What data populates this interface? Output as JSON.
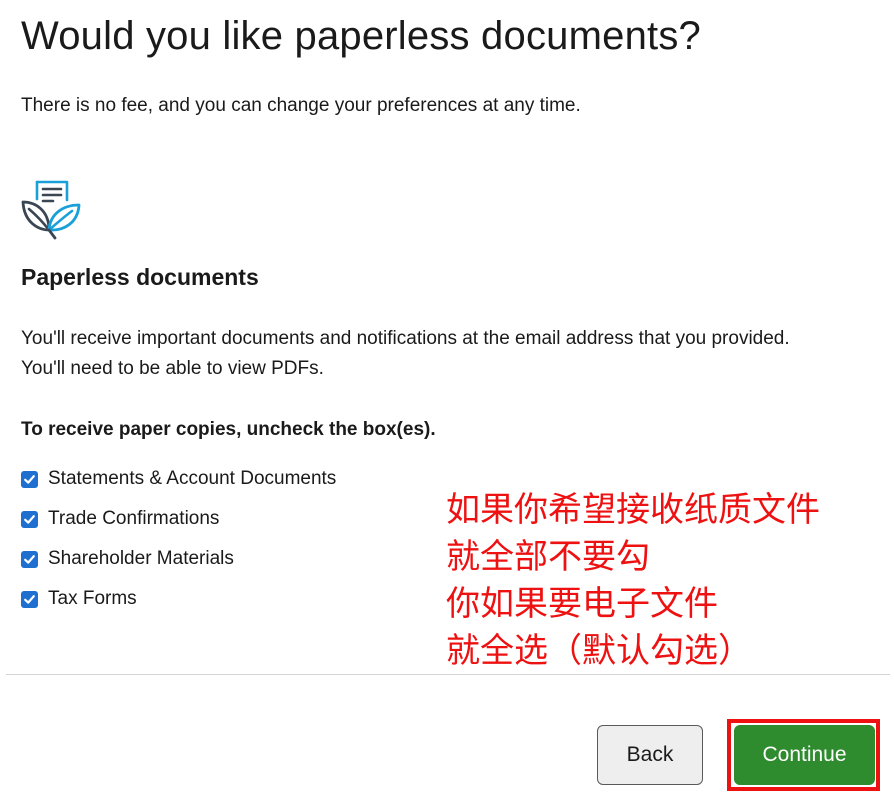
{
  "page": {
    "title": "Would you like paperless documents?",
    "subtitle": "There is no fee, and you can change your preferences at any time."
  },
  "paperless": {
    "icon": "paperless-document-leaf-icon",
    "heading": "Paperless documents",
    "description_line_1": "You'll receive important documents and notifications at the email address that you provided.",
    "description_line_2": "You'll need to be able to view PDFs.",
    "instruction": "To receive paper copies, uncheck the box(es).",
    "options": [
      {
        "label": "Statements & Account Documents",
        "checked": true
      },
      {
        "label": "Trade Confirmations",
        "checked": true
      },
      {
        "label": "Shareholder Materials",
        "checked": true
      },
      {
        "label": "Tax Forms",
        "checked": true
      }
    ]
  },
  "annotation": {
    "color": "#ee1111",
    "lines": [
      "如果你希望接收纸质文件",
      "就全部不要勾",
      "你如果要电子文件",
      "就全选（默认勾选）"
    ]
  },
  "actions": {
    "back_label": "Back",
    "continue_label": "Continue",
    "continue_color": "#2e8b2e",
    "highlight_color": "#ee1111"
  },
  "colors": {
    "checkbox": "#1f6fd1",
    "icon_dark": "#3a4654",
    "icon_accent": "#1aa0d8"
  }
}
